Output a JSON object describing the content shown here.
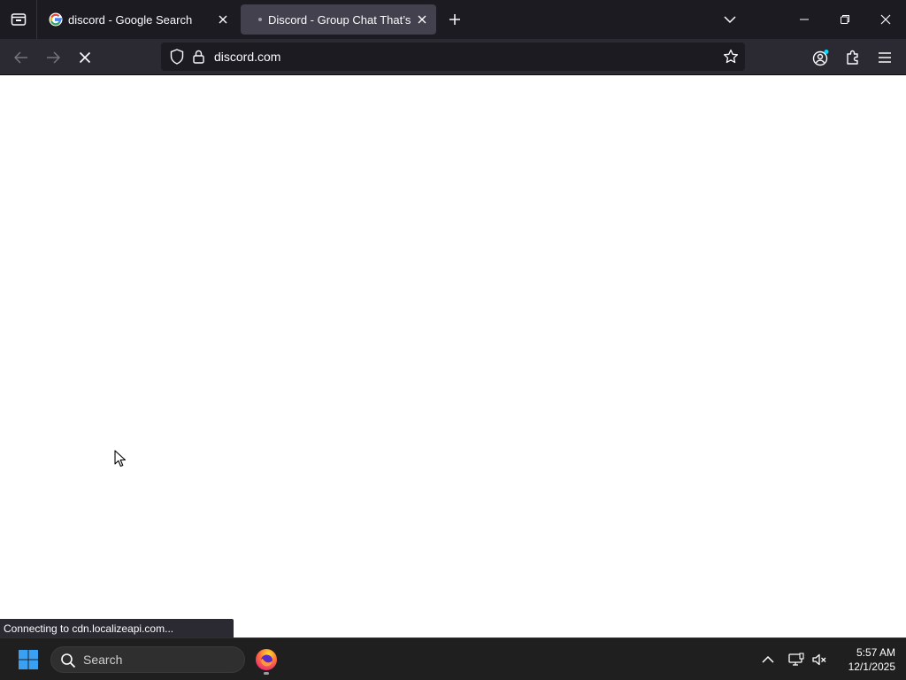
{
  "browser": {
    "tabs": [
      {
        "title": "discord - Google Search",
        "favicon": "google-g-icon",
        "active": false
      },
      {
        "title": "Discord - Group Chat That’s All Fun & Games",
        "favicon": "loading-dot-icon",
        "active": true
      }
    ],
    "url": "discord.com",
    "status": "Connecting to cdn.localizeapi.com..."
  },
  "taskbar": {
    "search_placeholder": "Search",
    "time": "5:57 AM",
    "date": "12/1/2025"
  },
  "colors": {
    "tabbar_bg": "#1c1b22",
    "navbar_bg": "#2b2a33",
    "active_tab_bg": "#42414d",
    "taskbar_bg": "#1f1f1f",
    "windows_blue": "#0078d4"
  }
}
